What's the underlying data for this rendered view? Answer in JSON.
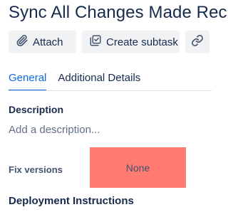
{
  "issue": {
    "title": "Sync All Changes Made Rec"
  },
  "toolbar": {
    "attach_label": "Attach",
    "create_subtask_label": "Create subtask"
  },
  "tabs": [
    {
      "label": "General",
      "active": true
    },
    {
      "label": "Additional Details",
      "active": false
    }
  ],
  "description": {
    "label": "Description",
    "placeholder": "Add a description..."
  },
  "fix_versions": {
    "label": "Fix versions",
    "value": "None"
  },
  "deployment": {
    "label": "Deployment Instructions"
  },
  "colors": {
    "accent": "#0c66e4",
    "highlight": "#ff7b72",
    "button_bg": "#f1f2f4"
  },
  "icons": [
    "paperclip-icon",
    "subtask-icon",
    "link-icon"
  ]
}
